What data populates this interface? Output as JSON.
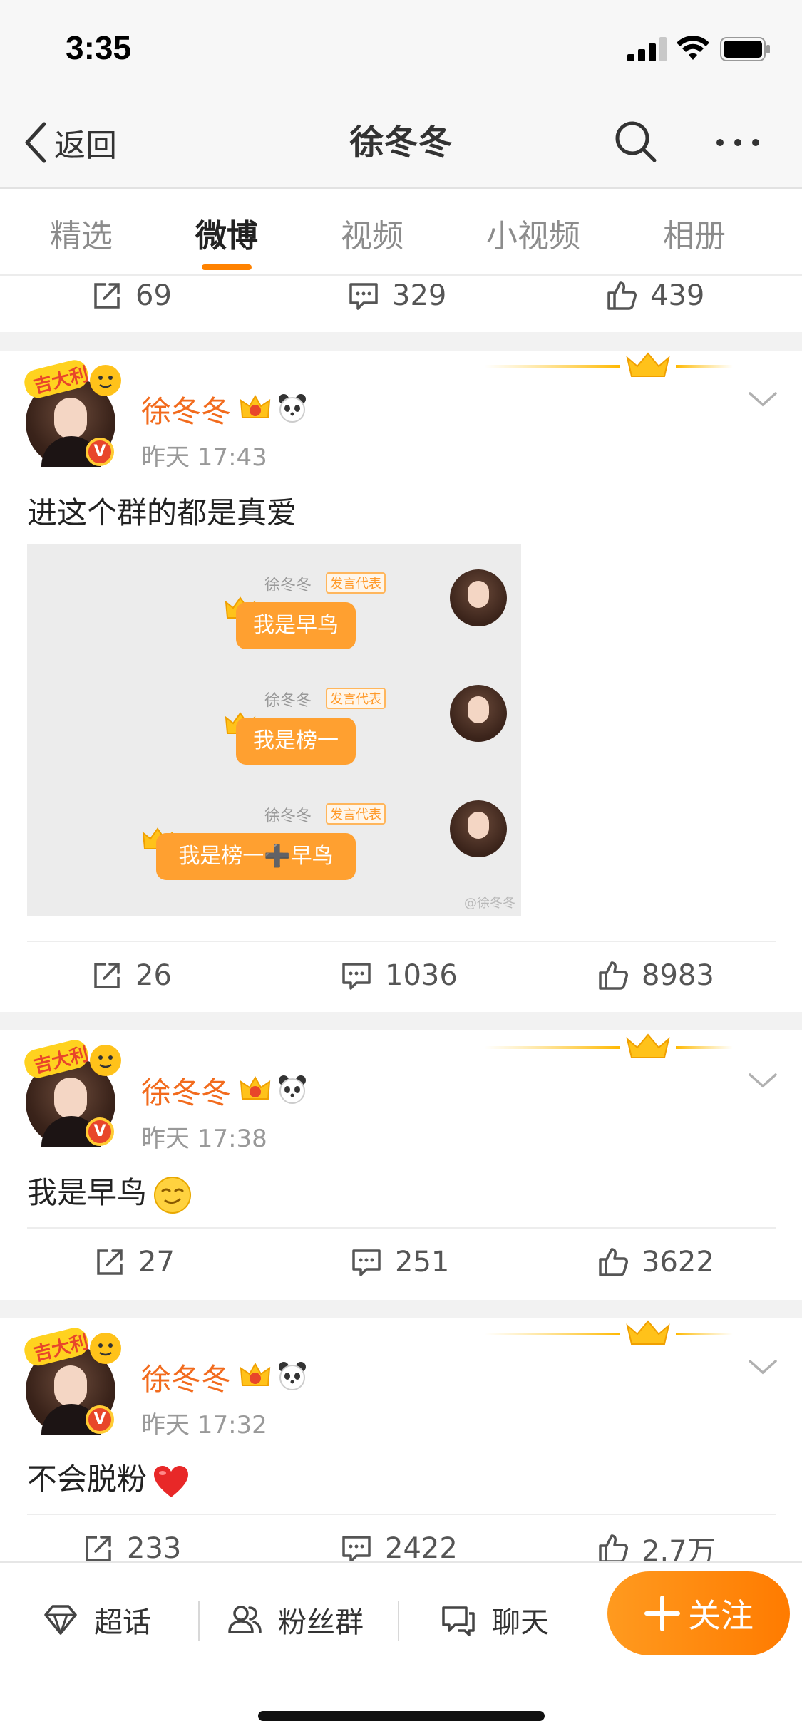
{
  "status_bar": {
    "time": "3:35"
  },
  "nav": {
    "back_label": "返回",
    "title": "徐冬冬"
  },
  "tabs": [
    "精选",
    "微博",
    "视频",
    "小视频",
    "相册"
  ],
  "active_tab": "微博",
  "colors": {
    "accent": "#ff8200",
    "name": "#f26b1d",
    "follow_button": "#ff8a00"
  },
  "top_actions": {
    "reposts": "69",
    "comments": "329",
    "likes": "439"
  },
  "posts": [
    {
      "author": "徐冬冬",
      "time": "昨天 17:43",
      "text": "进这个群的都是真爱",
      "image": {
        "messages": [
          {
            "sender": "徐冬冬",
            "tag": "发言代表",
            "text": "我是早鸟"
          },
          {
            "sender": "徐冬冬",
            "tag": "发言代表",
            "text": "我是榜一"
          },
          {
            "sender": "徐冬冬",
            "tag": "发言代表",
            "text": "我是榜一➕早鸟"
          }
        ],
        "watermark": "@徐冬冬"
      },
      "reposts": "26",
      "comments": "1036",
      "likes": "8983"
    },
    {
      "author": "徐冬冬",
      "time": "昨天 17:38",
      "text": "我是早鸟",
      "emoji": "smirk-face-emoji",
      "reposts": "27",
      "comments": "251",
      "likes": "3622"
    },
    {
      "author": "徐冬冬",
      "time": "昨天 17:32",
      "text": "不会脱粉",
      "emoji": "red-heart-emoji",
      "reposts": "233",
      "comments": "2422",
      "likes": "2.7万"
    }
  ],
  "bottom_bar": {
    "supertopic": "超话",
    "fan_group": "粉丝群",
    "chat": "聊天",
    "follow": "关注"
  }
}
